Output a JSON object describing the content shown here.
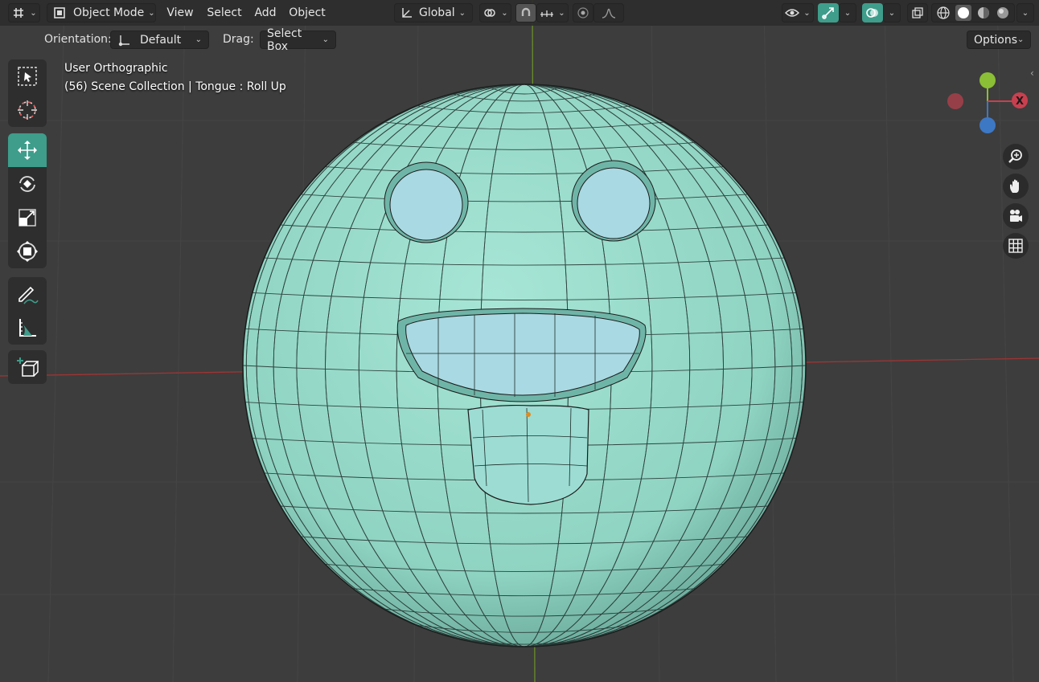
{
  "header": {
    "mode_label": "Object Mode",
    "menus": [
      "View",
      "Select",
      "Add",
      "Object"
    ],
    "transform_orientation": "Global"
  },
  "tool_settings": {
    "orientation_label": "Orientation:",
    "orientation_value": "Default",
    "drag_label": "Drag:",
    "drag_value": "Select Box",
    "options_label": "Options"
  },
  "viewport": {
    "view_name": "User Orthographic",
    "scene_info": "(56) Scene Collection | Tongue : Roll Up"
  },
  "gizmo": {
    "x_label": "X"
  },
  "colors": {
    "accent": "#3e9d8b",
    "mesh": "#8fd3c2",
    "x_axis": "#c8404f",
    "y_axis": "#8bbf35",
    "z_axis": "#3d78c4"
  },
  "icons": {
    "editor_type": "editor-type-icon",
    "object_mode": "object-mode-icon",
    "orientation": "orientation-icon",
    "pivot": "pivot-icon",
    "snap": "snap-icon",
    "proportional": "proportional-edit-icon",
    "visibility": "eye-icon",
    "gizmo_toggle": "gizmo-icon",
    "overlay_toggle": "overlay-icon",
    "xray": "xray-icon",
    "shading": [
      "wireframe-shading-icon",
      "solid-shading-icon",
      "material-shading-icon",
      "rendered-shading-icon"
    ],
    "tools": [
      "select-box-icon",
      "cursor-icon",
      "move-icon",
      "rotate-icon",
      "scale-icon",
      "transform-icon",
      "annotate-icon",
      "measure-icon",
      "add-cube-icon"
    ],
    "nav": [
      "zoom-icon",
      "pan-hand-icon",
      "camera-icon",
      "grid-icon"
    ]
  }
}
